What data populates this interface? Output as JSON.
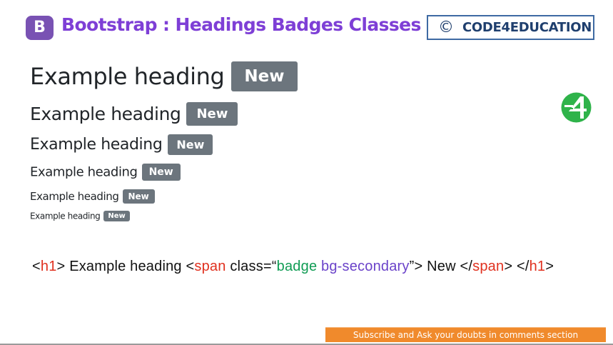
{
  "header": {
    "logo_letter": "B",
    "title": "Bootstrap : Headings Badges Classes",
    "brand_symbol": "©",
    "brand_text": "CODE4EDUCATION"
  },
  "headings": [
    {
      "level": "h1",
      "text": "Example heading",
      "badge": "New"
    },
    {
      "level": "h2",
      "text": "Example heading",
      "badge": "New"
    },
    {
      "level": "h3",
      "text": "Example heading",
      "badge": "New"
    },
    {
      "level": "h4",
      "text": "Example heading",
      "badge": "New"
    },
    {
      "level": "h5",
      "text": "Example heading",
      "badge": "New"
    },
    {
      "level": "h6",
      "text": "Example heading",
      "badge": "New"
    }
  ],
  "code": {
    "lt1": "<",
    "tag_h1_open": "h1",
    "gt1": ">",
    "text1": " Example heading ",
    "lt2": "<",
    "tag_span_open": "span",
    "attr": " class=“",
    "value1": "badge ",
    "value2": "bg-secondary",
    "close_quote": "”>",
    "text2": " New ",
    "lt3": "</",
    "tag_span_close": "span",
    "gt3": ">",
    "lt4": " </",
    "tag_h1_close": "h1",
    "gt4": ">"
  },
  "footer": {
    "subscribe": "Subscribe and Ask your doubts in comments section"
  },
  "colors": {
    "title": "#7e3fd6",
    "bootstrap_purple": "#7952b3",
    "badge_secondary": "#6c757d",
    "tag_red": "#e0301e",
    "value_green": "#109c54",
    "value_purple": "#6a42c9",
    "subscribe_orange": "#f08a2c",
    "brand_blue": "#3e6aa3",
    "logo_green": "#2fb34a"
  },
  "icons": {
    "bootstrap": "bootstrap-logo-icon",
    "code4education": "code4education-logo-icon"
  }
}
